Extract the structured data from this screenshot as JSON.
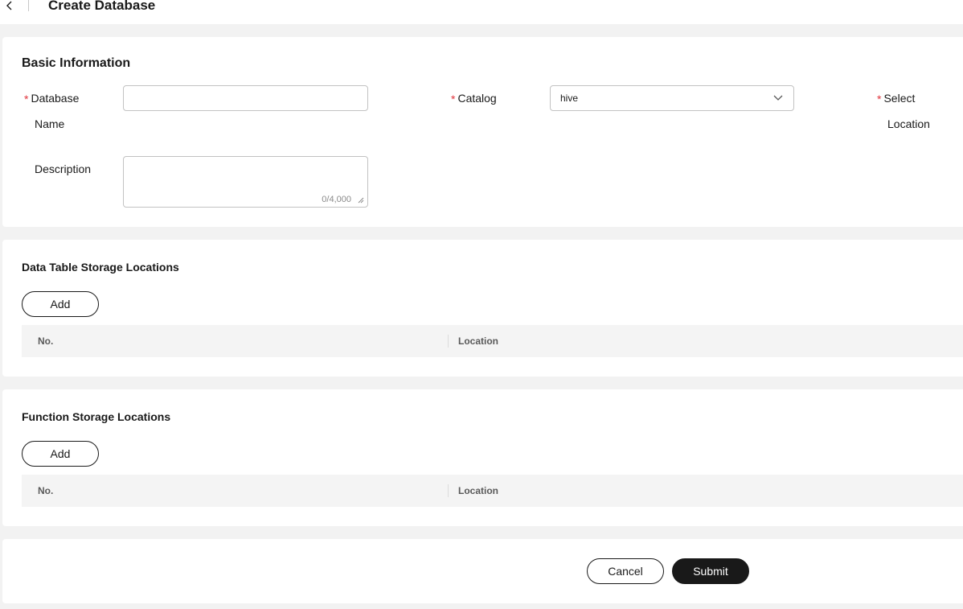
{
  "header": {
    "title": "Create Database",
    "back_icon": "chevron-left-icon"
  },
  "basic_info": {
    "title": "Basic Information",
    "database_name": {
      "label_line1": "Database",
      "label_line2": "Name",
      "value": "",
      "placeholder": ""
    },
    "catalog": {
      "label": "Catalog",
      "value": "hive",
      "icon": "chevron-down-icon"
    },
    "location": {
      "label_line1": "Select",
      "label_line2": "Location"
    },
    "description": {
      "label": "Description",
      "value": "",
      "counter": "0/4,000"
    },
    "required_marker": "*",
    "required_color": "#e0333b"
  },
  "data_table_locations": {
    "title": "Data Table Storage Locations",
    "add_label": "Add",
    "columns": [
      "No.",
      "Location"
    ]
  },
  "function_locations": {
    "title": "Function Storage Locations",
    "add_label": "Add",
    "columns": [
      "No.",
      "Location"
    ]
  },
  "footer": {
    "cancel_label": "Cancel",
    "submit_label": "Submit"
  },
  "colors": {
    "page_background": "#f2f2f2",
    "card_background": "#ffffff",
    "primary_button": "#191919",
    "table_header": "#f4f4f4"
  }
}
